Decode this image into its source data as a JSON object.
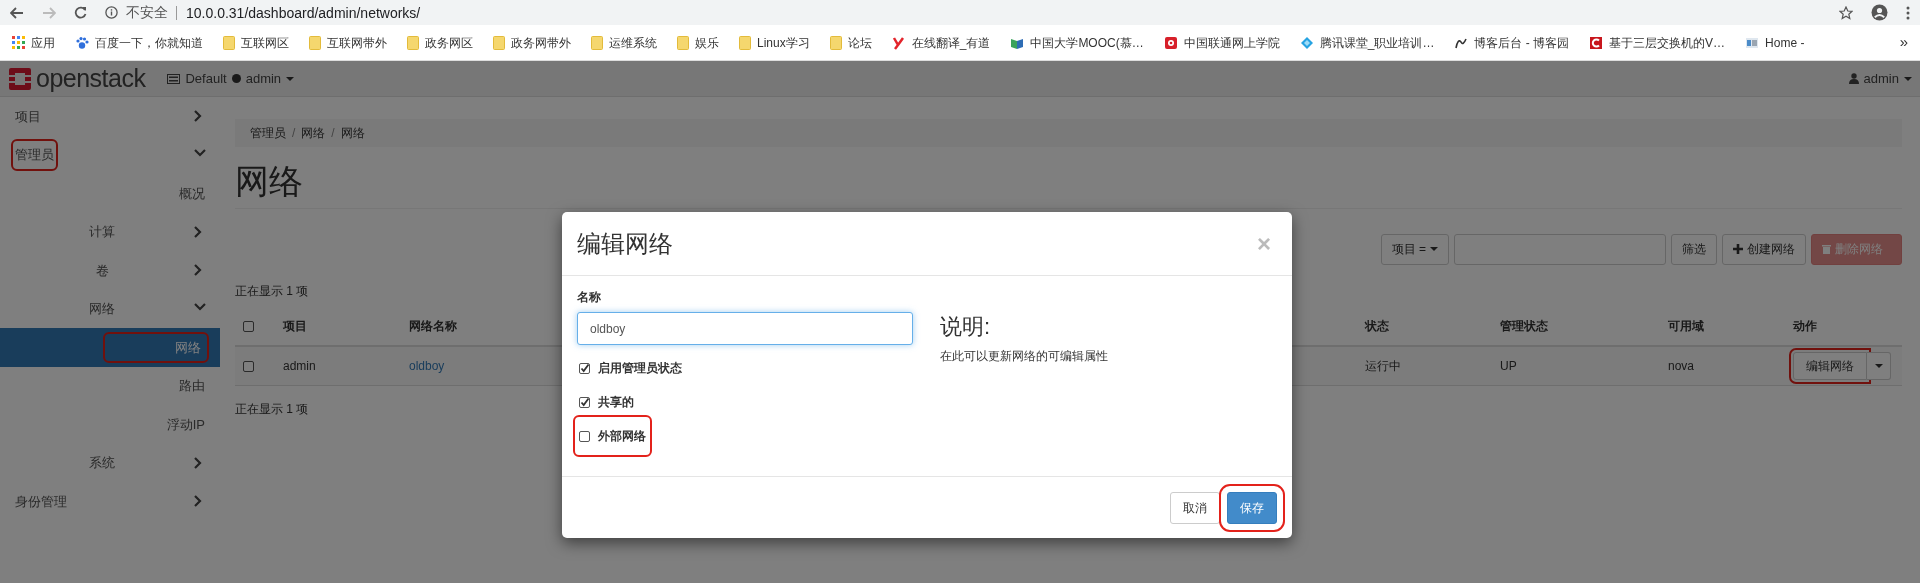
{
  "browser": {
    "security_label": "不安全",
    "url": "10.0.0.31/dashboard/admin/networks/"
  },
  "bookmarks": [
    {
      "kind": "apps",
      "label": "应用"
    },
    {
      "kind": "site",
      "label": "百度一下，你就知道"
    },
    {
      "kind": "folder",
      "label": "互联网区"
    },
    {
      "kind": "folder",
      "label": "互联网带外"
    },
    {
      "kind": "folder",
      "label": "政务网区"
    },
    {
      "kind": "folder",
      "label": "政务网带外"
    },
    {
      "kind": "folder",
      "label": "运维系统"
    },
    {
      "kind": "folder",
      "label": "娱乐"
    },
    {
      "kind": "folder",
      "label": "Linux学习"
    },
    {
      "kind": "folder",
      "label": "论坛"
    },
    {
      "kind": "site",
      "label": "在线翻译_有道"
    },
    {
      "kind": "site",
      "label": "中国大学MOOC(慕…"
    },
    {
      "kind": "site",
      "label": "中国联通网上学院"
    },
    {
      "kind": "site",
      "label": "腾讯课堂_职业培训…"
    },
    {
      "kind": "site",
      "label": "博客后台 - 博客园"
    },
    {
      "kind": "site",
      "label": "基于三层交换机的V…"
    },
    {
      "kind": "site",
      "label": "Home -"
    }
  ],
  "bookmarks_overflow": "»",
  "navbar": {
    "brand": "openstack",
    "domain": "Default",
    "project": "admin",
    "user": "admin"
  },
  "sidebar": [
    {
      "label": "项目",
      "expanded": false,
      "highlighted": false
    },
    {
      "label": "管理员",
      "expanded": true,
      "highlighted": true,
      "children": [
        {
          "label": "概况",
          "selected": false,
          "highlighted": false
        },
        {
          "label": "计算",
          "expanded": false,
          "highlighted": false
        },
        {
          "label": "卷",
          "expanded": false,
          "highlighted": false
        },
        {
          "label": "网络",
          "expanded": true,
          "highlighted": false,
          "children": [
            {
              "label": "网络",
              "selected": true,
              "highlighted": true
            },
            {
              "label": "路由",
              "selected": false,
              "highlighted": false
            },
            {
              "label": "浮动IP",
              "selected": false,
              "highlighted": false
            }
          ]
        },
        {
          "label": "系统",
          "expanded": false,
          "highlighted": false
        }
      ]
    },
    {
      "label": "身份管理",
      "expanded": false,
      "highlighted": false
    }
  ],
  "main": {
    "breadcrumb": [
      "管理员",
      "网络",
      "网络"
    ],
    "breadcrumb_separator": "/",
    "title": "网络",
    "toolbar": {
      "filter_field": "项目 =",
      "filter_button": "筛选",
      "create_button": "创建网络",
      "delete_button": "删除网络",
      "delete_disabled": true
    },
    "count_top": "正在显示 1 项",
    "table": {
      "all_checked": false,
      "columns": [
        {
          "label": "项目",
          "kind": "text"
        },
        {
          "label": "网络名称",
          "kind": "link"
        },
        {
          "label": "状态",
          "kind": "text"
        },
        {
          "label": "管理状态",
          "kind": "text"
        },
        {
          "label": "可用域",
          "kind": "text"
        },
        {
          "label": "动作",
          "kind": "action"
        }
      ],
      "rows": [
        {
          "checked": false,
          "cells": [
            "admin",
            "oldboy",
            "运行中",
            "UP",
            "nova",
            "编辑网络"
          ],
          "action_highlighted": true
        }
      ]
    },
    "count_bottom": "正在显示 1 项"
  },
  "modal": {
    "title": "编辑网络",
    "close": "×",
    "name_label": "名称",
    "name_value": "oldboy",
    "options": [
      {
        "label": "启用管理员状态",
        "checked": true,
        "highlighted": false
      },
      {
        "label": "共享的",
        "checked": true,
        "highlighted": false
      },
      {
        "label": "外部网络",
        "checked": false,
        "highlighted": true
      }
    ],
    "help_title": "说明:",
    "help_text": "在此可以更新网络的可编辑属性",
    "cancel": "取消",
    "save": "保存",
    "save_highlighted": true
  }
}
